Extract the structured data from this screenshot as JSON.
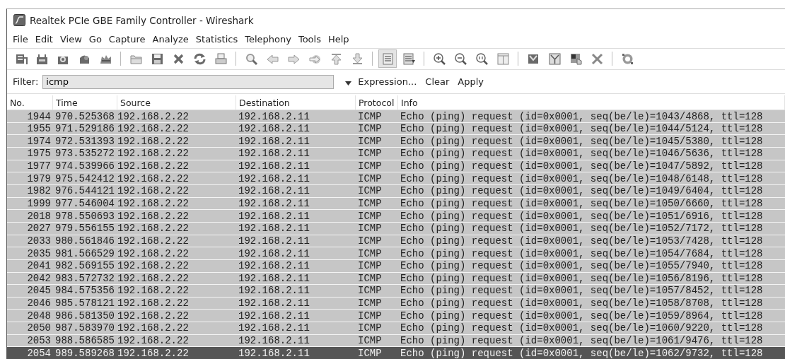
{
  "window": {
    "title": "Realtek PCIe GBE Family Controller - Wireshark"
  },
  "menu": [
    "File",
    "Edit",
    "View",
    "Go",
    "Capture",
    "Analyze",
    "Statistics",
    "Telephony",
    "Tools",
    "Help"
  ],
  "toolbar": {
    "groups": [
      [
        {
          "pressed": false
        },
        {
          "pressed": false
        },
        {
          "pressed": false
        },
        {
          "pressed": false
        },
        {
          "pressed": false
        }
      ],
      [
        {
          "pressed": false
        },
        {
          "pressed": false
        },
        {
          "pressed": false
        },
        {
          "pressed": false
        },
        {
          "pressed": false
        }
      ],
      [
        {
          "pressed": false
        },
        {
          "pressed": false
        },
        {
          "pressed": false
        },
        {
          "pressed": false
        },
        {
          "pressed": false
        },
        {
          "pressed": false
        }
      ],
      [
        {
          "pressed": true
        },
        {
          "pressed": false
        }
      ],
      [
        {
          "pressed": false
        },
        {
          "pressed": false
        },
        {
          "pressed": false
        },
        {
          "pressed": false
        }
      ],
      [
        {
          "pressed": false
        },
        {
          "pressed": false
        },
        {
          "pressed": false
        },
        {
          "pressed": false
        }
      ],
      [
        {
          "pressed": false
        }
      ]
    ]
  },
  "filter": {
    "label": "Filter:",
    "value": "icmp",
    "buttons": [
      "Expression...",
      "Clear",
      "Apply"
    ]
  },
  "table": {
    "columns": [
      "No.",
      "Time",
      "Source",
      "Destination",
      "Protocol",
      "Info"
    ],
    "rows": [
      {
        "no": "1944",
        "time": "970.525368",
        "source": "192.168.2.22",
        "destination": "192.168.2.11",
        "protocol": "ICMP",
        "info": "Echo (ping) request  (id=0x0001, seq(be/le)=1043/4868, ttl=128",
        "selected": false
      },
      {
        "no": "1955",
        "time": "971.529186",
        "source": "192.168.2.22",
        "destination": "192.168.2.11",
        "protocol": "ICMP",
        "info": "Echo (ping) request  (id=0x0001, seq(be/le)=1044/5124, ttl=128",
        "selected": false
      },
      {
        "no": "1974",
        "time": "972.531393",
        "source": "192.168.2.22",
        "destination": "192.168.2.11",
        "protocol": "ICMP",
        "info": "Echo (ping) request  (id=0x0001, seq(be/le)=1045/5380, ttl=128",
        "selected": false
      },
      {
        "no": "1975",
        "time": "973.535272",
        "source": "192.168.2.22",
        "destination": "192.168.2.11",
        "protocol": "ICMP",
        "info": "Echo (ping) request  (id=0x0001, seq(be/le)=1046/5636, ttl=128",
        "selected": false
      },
      {
        "no": "1977",
        "time": "974.539966",
        "source": "192.168.2.22",
        "destination": "192.168.2.11",
        "protocol": "ICMP",
        "info": "Echo (ping) request  (id=0x0001, seq(be/le)=1047/5892, ttl=128",
        "selected": false
      },
      {
        "no": "1979",
        "time": "975.542412",
        "source": "192.168.2.22",
        "destination": "192.168.2.11",
        "protocol": "ICMP",
        "info": "Echo (ping) request  (id=0x0001, seq(be/le)=1048/6148, ttl=128",
        "selected": false
      },
      {
        "no": "1982",
        "time": "976.544121",
        "source": "192.168.2.22",
        "destination": "192.168.2.11",
        "protocol": "ICMP",
        "info": "Echo (ping) request  (id=0x0001, seq(be/le)=1049/6404, ttl=128",
        "selected": false
      },
      {
        "no": "1999",
        "time": "977.546004",
        "source": "192.168.2.22",
        "destination": "192.168.2.11",
        "protocol": "ICMP",
        "info": "Echo (ping) request  (id=0x0001, seq(be/le)=1050/6660, ttl=128",
        "selected": false
      },
      {
        "no": "2018",
        "time": "978.550693",
        "source": "192.168.2.22",
        "destination": "192.168.2.11",
        "protocol": "ICMP",
        "info": "Echo (ping) request  (id=0x0001, seq(be/le)=1051/6916, ttl=128",
        "selected": false
      },
      {
        "no": "2027",
        "time": "979.556155",
        "source": "192.168.2.22",
        "destination": "192.168.2.11",
        "protocol": "ICMP",
        "info": "Echo (ping) request  (id=0x0001, seq(be/le)=1052/7172, ttl=128",
        "selected": false
      },
      {
        "no": "2033",
        "time": "980.561846",
        "source": "192.168.2.22",
        "destination": "192.168.2.11",
        "protocol": "ICMP",
        "info": "Echo (ping) request  (id=0x0001, seq(be/le)=1053/7428, ttl=128",
        "selected": false
      },
      {
        "no": "2035",
        "time": "981.566529",
        "source": "192.168.2.22",
        "destination": "192.168.2.11",
        "protocol": "ICMP",
        "info": "Echo (ping) request  (id=0x0001, seq(be/le)=1054/7684, ttl=128",
        "selected": false
      },
      {
        "no": "2041",
        "time": "982.569155",
        "source": "192.168.2.22",
        "destination": "192.168.2.11",
        "protocol": "ICMP",
        "info": "Echo (ping) request  (id=0x0001, seq(be/le)=1055/7940, ttl=128",
        "selected": false
      },
      {
        "no": "2042",
        "time": "983.572732",
        "source": "192.168.2.22",
        "destination": "192.168.2.11",
        "protocol": "ICMP",
        "info": "Echo (ping) request  (id=0x0001, seq(be/le)=1056/8196, ttl=128",
        "selected": false
      },
      {
        "no": "2045",
        "time": "984.575356",
        "source": "192.168.2.22",
        "destination": "192.168.2.11",
        "protocol": "ICMP",
        "info": "Echo (ping) request  (id=0x0001, seq(be/le)=1057/8452, ttl=128",
        "selected": false
      },
      {
        "no": "2046",
        "time": "985.578121",
        "source": "192.168.2.22",
        "destination": "192.168.2.11",
        "protocol": "ICMP",
        "info": "Echo (ping) request  (id=0x0001, seq(be/le)=1058/8708, ttl=128",
        "selected": false
      },
      {
        "no": "2048",
        "time": "986.581350",
        "source": "192.168.2.22",
        "destination": "192.168.2.11",
        "protocol": "ICMP",
        "info": "Echo (ping) request  (id=0x0001, seq(be/le)=1059/8964, ttl=128",
        "selected": false
      },
      {
        "no": "2050",
        "time": "987.583970",
        "source": "192.168.2.22",
        "destination": "192.168.2.11",
        "protocol": "ICMP",
        "info": "Echo (ping) request  (id=0x0001, seq(be/le)=1060/9220, ttl=128",
        "selected": false
      },
      {
        "no": "2053",
        "time": "988.586585",
        "source": "192.168.2.22",
        "destination": "192.168.2.11",
        "protocol": "ICMP",
        "info": "Echo (ping) request  (id=0x0001, seq(be/le)=1061/9476, ttl=128",
        "selected": false
      },
      {
        "no": "2054",
        "time": "989.589268",
        "source": "192.168.2.22",
        "destination": "192.168.2.11",
        "protocol": "ICMP",
        "info": "Echo (ping) request  (id=0x0001, seq(be/le)=1062/9732, ttl=128",
        "selected": true
      }
    ]
  }
}
